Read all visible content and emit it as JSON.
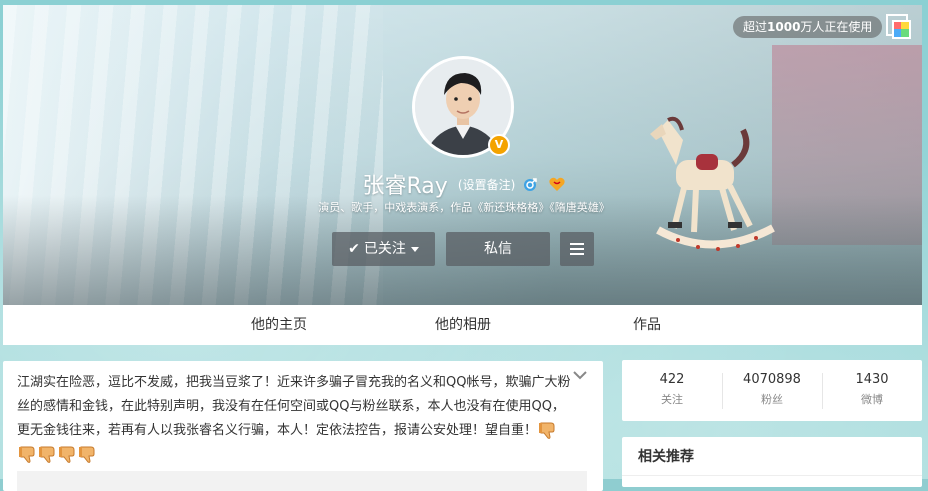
{
  "header": {
    "users_badge_prefix": "超过",
    "users_badge_count": "1000",
    "users_badge_suffix": "万人正在使用"
  },
  "profile": {
    "name": "张睿Ray",
    "remark_label": "(设置备注)",
    "verified_mark": "V",
    "intro": "演员、歌手，中戏表演系，作品《新还珠格格》《隋唐英雄》",
    "gender_icon": "male-icon",
    "vip_icon": "vip-heart-icon"
  },
  "actions": {
    "follow_label": "已关注",
    "message_label": "私信",
    "menu_icon": "menu-icon"
  },
  "tabs": [
    {
      "label": "他的主页"
    },
    {
      "label": "他的相册"
    },
    {
      "label": "作品"
    }
  ],
  "announcement": {
    "text": "江湖实在险恶，逗比不发威，把我当豆浆了！近来许多骗子冒充我的名义和QQ帐号，欺骗广大粉丝的感情和金钱，在此特别声明，我没有在任何空间或QQ与粉丝联系，本人也没有在使用QQ，更无金钱往来，若再有人以我张睿名义行骗，本人！定依法控告，报请公安处理！望自重！",
    "emoji_icon": "thumbs-down-icon",
    "emoji_count": 5
  },
  "stats": [
    {
      "value": "422",
      "label": "关注"
    },
    {
      "value": "4070898",
      "label": "粉丝"
    },
    {
      "value": "1430",
      "label": "微博"
    }
  ],
  "recommend": {
    "title": "相关推荐"
  },
  "colors": {
    "accent_verified": "#f4a300",
    "button_bg": "#5a5f64",
    "page_bg": "#8fcdd0"
  }
}
